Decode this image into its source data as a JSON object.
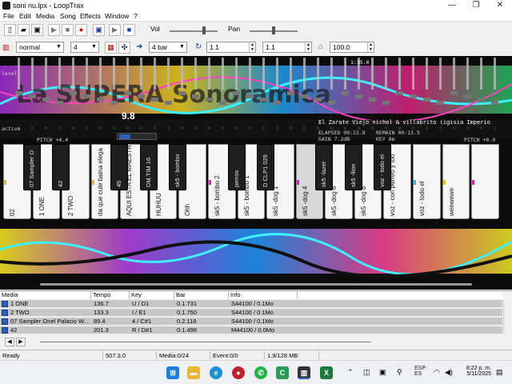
{
  "window": {
    "title": "soni nu.lpx - LoopTrax",
    "minimize": "—",
    "maximize": "❐",
    "close": "✕"
  },
  "menu": [
    "File",
    "Edit",
    "Media",
    "Song",
    "Effects",
    "Window",
    "?"
  ],
  "toolbar1": {
    "vol_label": "Vol",
    "pan_label": "Pan",
    "buttons": [
      "new-icon",
      "open-icon",
      "save-icon",
      "play-icon",
      "stop-icon",
      "record-icon",
      "loop-icon",
      "play-next-icon",
      "stop-all-icon"
    ],
    "vol_level": 0.72,
    "pan_level": 0.5
  },
  "toolbar2": {
    "keyboard_mode": "normal",
    "octave": "4",
    "bars": "4 bar",
    "position": "1.1",
    "position2": "1.1",
    "tempo": "100.0"
  },
  "stage": {
    "level_label": "level",
    "active_label": "active",
    "counter": "9.8",
    "time_display": "1:35.0",
    "elapsed": "ELAPSED 00:22.8",
    "gain": "GAIN 7.2dB",
    "remain": "REMAIN 00:13.5",
    "key": "KEY Am",
    "clip_title": "El Zarate Viejo nichol & villabrito (igisia Imperio",
    "pitch_left": "PITCH +4.4",
    "pitch_right": "PITCH +0.0",
    "graffiti_text": "La SUPERA Sonoramica"
  },
  "keyboard": {
    "white_keys": [
      {
        "label": "02",
        "pressed": false
      },
      {
        "label": "1 ONE",
        "pressed": false
      },
      {
        "label": "2 TWO",
        "pressed": false
      },
      {
        "label": "da que cule baina elega",
        "pressed": false
      },
      {
        "label": "AQUI ESTA EL MAESTRO",
        "pressed": false
      },
      {
        "label": "HUHUU",
        "pressed": false
      },
      {
        "label": "Ohh",
        "pressed": false
      },
      {
        "label": "sk5 - bombo 2",
        "pressed": false
      },
      {
        "label": "sk5 - bombo 1",
        "pressed": false
      },
      {
        "label": "sk5 -dog 1",
        "pressed": false
      },
      {
        "label": "sk5 -dog 4",
        "pressed": true
      },
      {
        "label": "sk5 -dog 6",
        "pressed": false
      },
      {
        "label": "sk5 -dog 8",
        "pressed": false
      },
      {
        "label": "voz - con perreo y too",
        "pressed": false
      },
      {
        "label": "voz - todo el",
        "pressed": false
      },
      {
        "label": "weewewe",
        "pressed": false
      },
      {
        "label": "",
        "pressed": false
      }
    ],
    "black_keys": [
      {
        "label": "07 Sampler O"
      },
      {
        "label": "42"
      },
      {
        "label": "45"
      },
      {
        "label": "DM.TIM 16"
      },
      {
        "label": "sk5 - bombo"
      },
      {
        "label": "perros"
      },
      {
        "label": "D CLP1 029"
      },
      {
        "label": "sk5 -lazer"
      },
      {
        "label": "sk5 -llion"
      },
      {
        "label": "voz - todo el"
      }
    ]
  },
  "media_list": {
    "columns": [
      "Media",
      "Tempo",
      "Key",
      "Bar",
      "Info"
    ],
    "rows": [
      {
        "media": "1 ONE",
        "tempo": "136.7",
        "key": "U / D1",
        "bar": "0.1.731",
        "info": "S44100 / 0.1Mo"
      },
      {
        "media": "2 TWO",
        "tempo": "133.3",
        "key": "I / E1",
        "bar": "0.1.750",
        "info": "S44100 / 0.1Mo"
      },
      {
        "media": "07 Sampler Onel Palacio W...",
        "tempo": "89.4",
        "key": "4 / C#1",
        "bar": "0.2.118",
        "info": "S44100 / 0.1Mo"
      },
      {
        "media": "42",
        "tempo": "201.3",
        "key": "R / D#1",
        "bar": "0.1.496",
        "info": "M44100 / 0.0Mo"
      }
    ]
  },
  "navbar": {
    "prev": "◀",
    "next": "▶"
  },
  "status": {
    "ready": "Ready",
    "position": "507.3.0",
    "media": "Media:0/24",
    "event": "Event:0/0",
    "memory": "1.9/128 MB"
  },
  "taskbar": {
    "lang": "ESP",
    "lang2": "ES",
    "time": "8:22 p. m.",
    "date": "5/11/2025",
    "apps": [
      "start-icon",
      "explorer-icon",
      "edge-icon",
      "media-icon",
      "whatsapp-icon",
      "camtasia-icon",
      "looptrax-icon",
      "excel-icon"
    ]
  },
  "colors": {
    "stage_bg": "#0b0b0b",
    "accent": "#2e5fbf",
    "row_bg": "#c8c8c8"
  }
}
